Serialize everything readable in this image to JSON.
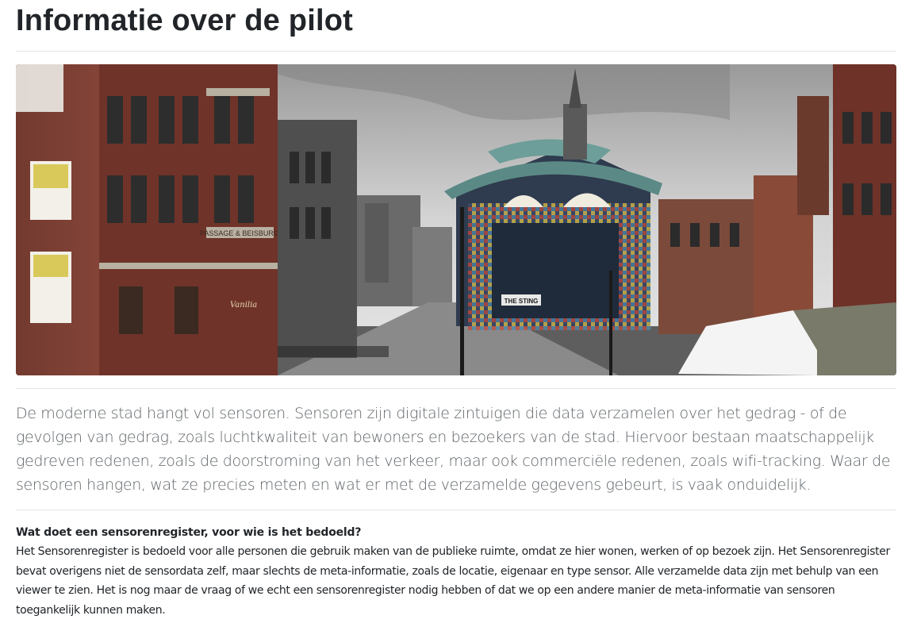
{
  "page": {
    "title": "Informatie over de pilot"
  },
  "hero": {
    "scene": "street-square-with-pavilion",
    "sign_passage": "PASSAGE & BEISBURG",
    "sign_sting": "THE STING",
    "sign_vanilia": "Vanilia"
  },
  "intro": {
    "text": "De moderne stad hangt vol sensoren. Sensoren zijn digitale zintuigen die data verzamelen over het gedrag - of de gevolgen van gedrag, zoals luchtkwaliteit van bewoners en bezoekers van de stad. Hiervoor bestaan maatschappelijk gedreven redenen, zoals de doorstroming van het verkeer, maar ook commerciële redenen, zoals wifi-tracking. Waar de sensoren hangen, wat ze precies meten en wat er met de verzamelde gegevens gebeurt, is vaak onduidelijk."
  },
  "section": {
    "heading": "Wat doet een sensorenregister, voor wie is het bedoeld?",
    "body": "Het Sensorenregister is bedoeld voor alle personen die gebruik maken van de publieke ruimte, omdat ze hier wonen, werken of op bezoek zijn. Het Sensorenregister bevat overigens niet de sensordata zelf, maar slechts de meta-informatie, zoals de locatie, eigenaar en type sensor. Alle verzamelde data zijn met behulp van een viewer te zien. Het is nog maar de vraag of we echt een sensorenregister nodig hebben of dat we op een andere manier de meta-informatie van sensoren toegankelijk kunnen maken."
  },
  "colors": {
    "brick": "#7a3e32",
    "sky": "#c9c9c9",
    "pavilion_roof": "#5b8a86",
    "text_muted": "#5f6468",
    "rule": "#e2e5e8"
  }
}
